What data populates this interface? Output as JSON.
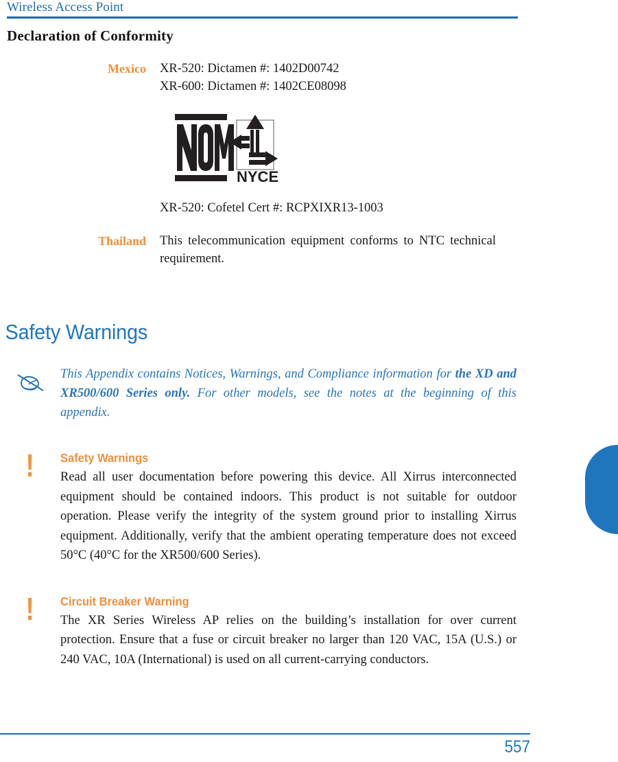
{
  "header": {
    "running_title": "Wireless Access Point"
  },
  "sections": {
    "declaration": {
      "title": "Declaration of Conformity",
      "rows": [
        {
          "label": "Mexico",
          "lines": [
            "XR-520: Dictamen #: 1402D00742",
            "XR-600: Dictamen #: 1402CE08098"
          ]
        },
        {
          "label": "",
          "lines": [
            "XR-520: Cofetel Cert #: RCPXIXR13-1003"
          ]
        },
        {
          "label": "Thailand",
          "lines": [
            "This telecommunication equipment conforms to NTC technical requirement."
          ]
        }
      ],
      "logo": {
        "nom_text": "NOM",
        "nyce_text": "NYCE",
        "alt": "NOM NYCE certification mark"
      }
    },
    "safety": {
      "heading": "Safety Warnings",
      "note": {
        "icon": "note-pen-icon",
        "text_part1": "This Appendix contains Notices, Warnings, and Compliance information for ",
        "text_bold": "the XD and XR500/600 Series only.",
        "text_part2": " For other models, see the notes at the beginning of this appendix."
      },
      "warnings": [
        {
          "icon": "exclamation-icon",
          "bang": "!",
          "title": "Safety Warnings",
          "text": "Read all user documentation before powering this device. All Xirrus interconnected equipment should be contained indoors. This product is not suitable for outdoor operation. Please verify the integrity of the system ground prior to installing Xirrus equipment. Additionally, verify that the ambient operating temperature does not exceed 50°C (40°C for the XR500/600 Series)."
        },
        {
          "icon": "exclamation-icon",
          "bang": "!",
          "title": "Circuit Breaker Warning",
          "text": "The XR Series Wireless AP relies on the building’s installation for over current protection. Ensure that a fuse or circuit breaker no larger than 120 VAC, 15A (U.S.) or 240 VAC, 10A (International) is used on all current-carrying conductors."
        }
      ]
    }
  },
  "footer": {
    "page_number": "557"
  },
  "colors": {
    "brand_blue": "#1f76bd",
    "rule_blue": "#1a69ad",
    "accent_orange": "#ef8f3c",
    "note_blue": "#2b74b8",
    "body_black": "#1a1a1a"
  }
}
